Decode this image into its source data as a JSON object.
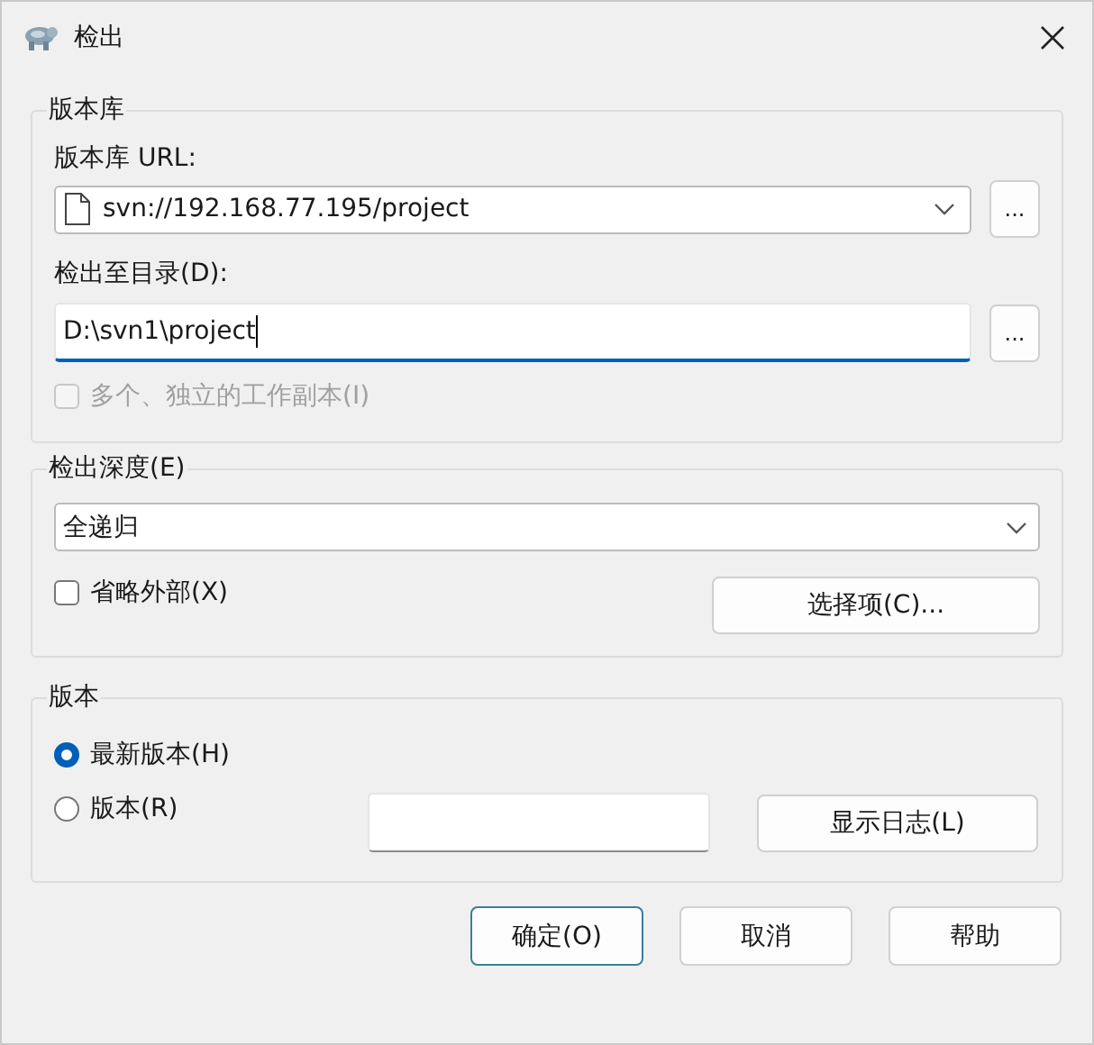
{
  "window": {
    "title": "检出"
  },
  "repository": {
    "legend": "版本库",
    "url_label": "版本库 URL:",
    "url": "svn://192.168.77.195/project",
    "url_browse": "...",
    "dir_label": "检出至目录(D):",
    "dir": "D:\\svn1\\project",
    "dir_focused": true,
    "dir_browse": "...",
    "multiple": {
      "label": "多个、独立的工作副本(I)",
      "checked": false,
      "disabled": true
    }
  },
  "depth": {
    "legend": "检出深度(E)",
    "value": "全递归",
    "omit_externals": {
      "label": "省略外部(X)",
      "checked": false,
      "disabled": false
    },
    "choose_items": "选择项(C)..."
  },
  "revision": {
    "legend": "版本",
    "options": [
      {
        "label": "最新版本(H)",
        "selected": true
      },
      {
        "label": "版本(R)",
        "selected": false
      }
    ],
    "show_log": "显示日志(L)"
  },
  "buttons": [
    {
      "label": "确定(O)",
      "default": true
    },
    {
      "label": "取消",
      "default": false
    },
    {
      "label": "帮助",
      "default": false
    }
  ]
}
